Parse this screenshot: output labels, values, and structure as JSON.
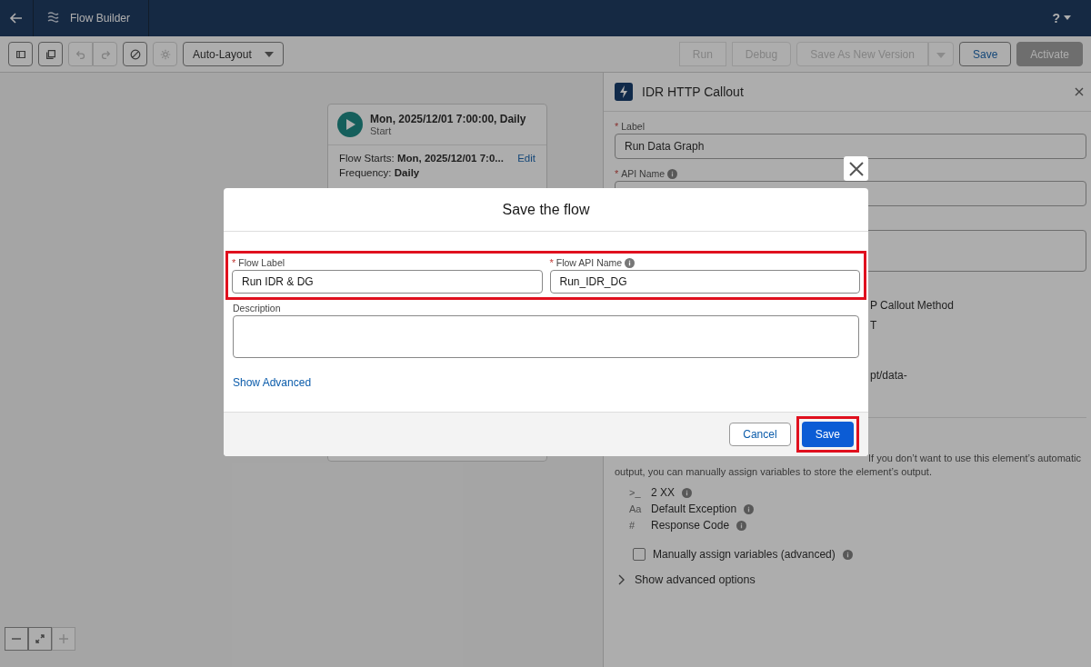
{
  "header": {
    "title": "Flow Builder",
    "help": "?"
  },
  "toolbar": {
    "icon_buttons": [
      {
        "kind": "panel",
        "disabled": false
      },
      {
        "kind": "copy",
        "disabled": false
      },
      {
        "kind": "undo",
        "disabled": true
      },
      {
        "kind": "redo",
        "disabled": true
      },
      {
        "kind": "block",
        "disabled": false
      },
      {
        "kind": "gear",
        "disabled": true
      }
    ],
    "layout_select": "Auto-Layout",
    "actions": [
      {
        "label": "Run",
        "kind": "group",
        "disabled": true
      },
      {
        "label": "Debug",
        "kind": "group",
        "disabled": true
      },
      {
        "label": "Save As New Version",
        "kind": "split",
        "disabled": true
      },
      {
        "label": "Save",
        "kind": "outline",
        "disabled": false
      },
      {
        "label": "Activate",
        "kind": "brand",
        "disabled": true
      }
    ]
  },
  "start_node": {
    "title": "Mon, 2025/12/01 7:00:00, Daily",
    "subtitle": "Start",
    "rows": [
      {
        "label": "Flow Starts:",
        "value": "Mon, 2025/12/01 7:0...",
        "link": "Edit"
      },
      {
        "label": "Frequency:",
        "value": "Daily"
      }
    ]
  },
  "panel": {
    "title": "IDR HTTP Callout",
    "fields": [
      {
        "label": "Label",
        "required_mark": "*",
        "value": "Run Data Graph",
        "info": false
      },
      {
        "label": "API Name",
        "required_mark": "*",
        "info": true
      }
    ],
    "partial_texts": [
      "P Callout Method",
      "T",
      "pt/data-"
    ],
    "output_text": [
      "If you don’t want to use this element’s automatic",
      "output, you can manually assign variables to store the element’s output."
    ],
    "outputs": [
      {
        "glyph": ">_",
        "label": "2 XX"
      },
      {
        "glyph": "Aa",
        "label": "Default Exception"
      },
      {
        "glyph": "#",
        "label": "Response Code"
      }
    ],
    "manual_assign": {
      "label": "Manually assign variables (advanced)",
      "checked": false
    },
    "advanced": {
      "label": "Show advanced options",
      "expanded": false
    }
  },
  "modal": {
    "title": "Save the flow",
    "fields": [
      {
        "label": "Flow Label",
        "required_mark": "*",
        "value": "Run IDR & DG",
        "info": false
      },
      {
        "label": "Flow API Name",
        "required_mark": "*",
        "value": "Run_IDR_DG",
        "info": true
      }
    ],
    "description_label": "Description",
    "advanced_link": "Show Advanced",
    "cancel": "Cancel",
    "save": "Save"
  }
}
